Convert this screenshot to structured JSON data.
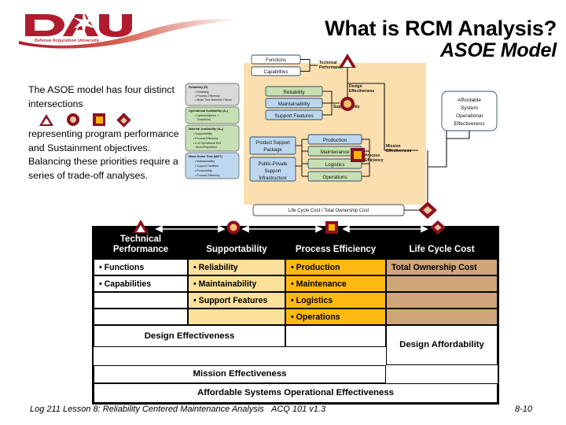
{
  "logo": {
    "brand": "DAU",
    "tagline": "Defense Acquisition University",
    "icon": "dau-logo-icon"
  },
  "title": {
    "main": "What is RCM Analysis?",
    "sub": "ASOE Model"
  },
  "lead": {
    "part1": "The ASOE model has four distinct intersections",
    "part2": "representing program performance and Sustainment objectives. Balancing these priorities require a series of trade-off analyses.",
    "shapes": [
      {
        "name": "triangle-marker",
        "label": "Technical Performance",
        "outline": "#8C1021",
        "fill": "#FFFFFF"
      },
      {
        "name": "circle-marker",
        "label": "Supportability",
        "outline": "#8C1021",
        "fill": "#E8C59A"
      },
      {
        "name": "square-marker",
        "label": "Process Efficiency",
        "outline": "#8C1021",
        "fill": "#FFB300"
      },
      {
        "name": "diamond-marker",
        "label": "Life Cycle Cost",
        "outline": "#8C1021",
        "fill": "#E8C59A"
      }
    ]
  },
  "diagram": {
    "metrics": [
      {
        "title": "Reliability (R)",
        "items": [
          "Reliability",
          "Process Efficiency",
          "Mean Time Between Failure"
        ],
        "color": "#D9D9D9"
      },
      {
        "title": "Operational Availability (Ao)",
        "items": [
          "Uptime/(Uptime + Downtime)"
        ],
        "color": "#C6E0B4"
      },
      {
        "title": "Material Availability (Am)",
        "items": [
          "Supportability",
          "Process Efficiency",
          "# of Operational End Items/Population"
        ],
        "color": "#C6E0B4"
      },
      {
        "title": "Mean Down Time (MDT)",
        "items": [
          "Maintainability",
          "Support Facilities",
          "Producibility",
          "Process Efficiency"
        ],
        "color": "#BDD7EE"
      }
    ],
    "tech_nodes": [
      "Functions",
      "Capabilities"
    ],
    "tech_label": "Technical Performance",
    "support_nodes": [
      "Reliability",
      "Maintainability",
      "Support Features"
    ],
    "support_label": "Supportability",
    "pkg_nodes": [
      "Product Support Package",
      "Public-Private Support Infrastructure"
    ],
    "process_nodes": [
      "Production",
      "Maintenance",
      "Logistics",
      "Operations"
    ],
    "process_label": "Process Efficiency",
    "cost_node": "Life Cycle Cost / Total Ownership Cost",
    "design_eff_label": "Design Effectiveness",
    "mission_eff_label": "Mission Effectiveness",
    "asoe_node": "Affordable System Operational Effectiveness"
  },
  "matrix": {
    "headers": [
      {
        "label": "Technical Performance",
        "marker": "triangle"
      },
      {
        "label": "Supportability",
        "marker": "circle"
      },
      {
        "label": "Process Efficiency",
        "marker": "square"
      },
      {
        "label": "Life Cycle Cost",
        "marker": "diamond"
      }
    ],
    "columns": [
      {
        "color": "#FFFFFF",
        "cells": [
          "• Functions",
          "• Capabilities",
          "",
          ""
        ]
      },
      {
        "color": "#FDE09A",
        "cells": [
          "• Reliability",
          "• Maintainability",
          "• Support Features",
          ""
        ]
      },
      {
        "color": "#FFB911",
        "cells": [
          "• Production",
          "• Maintenance",
          "• Logistics",
          "• Operations"
        ]
      },
      {
        "color": "#CFA679",
        "cells": [
          "Total Ownership Cost",
          "",
          "",
          ""
        ]
      }
    ],
    "summary": {
      "design_effectiveness": "Design Effectiveness",
      "design_affordability": "Design Affordability",
      "mission_effectiveness": "Mission Effectiveness",
      "asoe": "Affordable Systems Operational Effectiveness"
    }
  },
  "footer": {
    "left": "Log 211 Lesson 8: Reliability Centered Maintenance Analysis",
    "middle": "ACQ 101 v1.3",
    "right": "8-10"
  }
}
